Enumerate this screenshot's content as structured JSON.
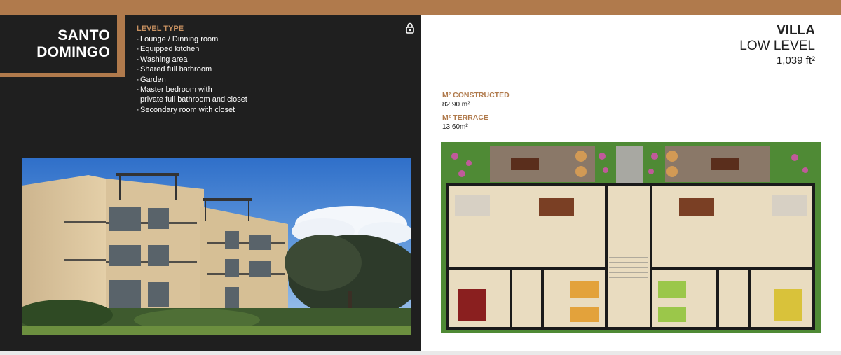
{
  "brand": {
    "accent": "#b07a4c",
    "panel": "#1f1f1f"
  },
  "location": {
    "line1": "SANTO",
    "line2": "DOMINGO"
  },
  "features": {
    "heading": "LEVEL TYPE",
    "items": [
      "Lounge / Dinning room",
      "Equipped kitchen",
      "Washing area",
      "Shared full bathroom",
      "Garden",
      "Master bedroom with",
      "private full bathroom and closet",
      "Secondary room with closet"
    ]
  },
  "unit": {
    "type": "VILLA",
    "level": "LOW LEVEL",
    "area": "1,039 ft²"
  },
  "specs": {
    "constructed_label": "M² CONSTRUCTED",
    "constructed_value": "82.90 m²",
    "terrace_label": "M² TERRACE",
    "terrace_value": "13.60m²"
  },
  "icons": {
    "top_right_of_panel": "lock-icon"
  }
}
